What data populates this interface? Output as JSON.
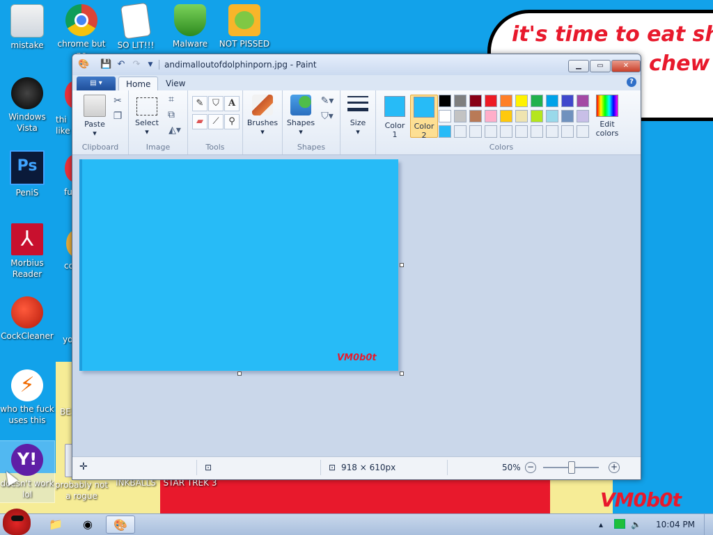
{
  "wallpaper": {
    "bubble_line1": "it's time to eat shit",
    "bubble_line2": "chew",
    "signature": "VM0b0t",
    "colors": {
      "sky": "#12a2ea",
      "red": "#e8192c",
      "yellow": "#f6ec96"
    }
  },
  "desktop_icons": [
    {
      "label": "mistake",
      "icon": "document-icon"
    },
    {
      "label": "chrome but no",
      "icon": "chrome-icon"
    },
    {
      "label": "SO LIT!!!",
      "icon": "playing-cards-icon"
    },
    {
      "label": "Malware",
      "icon": "shield-check-icon"
    },
    {
      "label": "NOT PISSED",
      "icon": "green-pig-icon"
    },
    {
      "label": "Windows Vista",
      "icon": "vista-orb-icon"
    },
    {
      "label": "PeniS",
      "icon": "photoshop-icon"
    },
    {
      "label": "Morbius Reader",
      "icon": "pdf-reader-icon"
    },
    {
      "label": "CockCleaner",
      "icon": "ccleaner-icon"
    },
    {
      "label": "who the fuck uses this",
      "icon": "lightning-icon"
    },
    {
      "label": "doesn't work lol",
      "icon": "yahoo-messenger-icon"
    },
    {
      "label": "probably not a rogue",
      "icon": "document-icon"
    },
    {
      "label": "INKBALLS",
      "icon": "game-icon"
    },
    {
      "label": "STAR TREK 3",
      "icon": "game-icon"
    }
  ],
  "partial_labels": {
    "thi": "thi",
    "like": "like",
    "fu": "fu",
    "co": "co",
    "yo": "yo",
    "be": "BE"
  },
  "paint": {
    "title": "andimalloutofdolphinporn.jpg - Paint",
    "tabs": [
      "Home",
      "View"
    ],
    "groups": {
      "clipboard": "Clipboard",
      "image": "Image",
      "tools": "Tools",
      "shapes": "Shapes",
      "colors": "Colors"
    },
    "buttons": {
      "paste": "Paste",
      "select": "Select",
      "brushes": "Brushes",
      "shapes": "Shapes",
      "size": "Size",
      "color1": "Color 1",
      "color2": "Color 2",
      "edit_colors": "Edit colors"
    },
    "color1": "#27bbf7",
    "color2": "#27bbf7",
    "palette": [
      "#000000",
      "#7f7f7f",
      "#880015",
      "#ed1c24",
      "#ff7f27",
      "#fff200",
      "#22b14c",
      "#00a2e8",
      "#3f48cc",
      "#a349a4",
      "#ffffff",
      "#c3c3c3",
      "#b97a57",
      "#ffaec9",
      "#ffc90e",
      "#efe4b0",
      "#b5e61d",
      "#99d9ea",
      "#7092be",
      "#c8bfe7",
      "#27bbf7",
      "#e8eef6",
      "#e8eef6",
      "#e8eef6",
      "#e8eef6",
      "#e8eef6",
      "#e8eef6",
      "#e8eef6",
      "#e8eef6",
      "#e8eef6"
    ],
    "canvas_color": "#27bbf7",
    "canvas_signature": "VM0b0t",
    "status": {
      "dimensions": "918 × 610px",
      "zoom": "50%",
      "zoom_fraction": 0.5
    }
  },
  "taskbar": {
    "time": "10:04 PM"
  }
}
